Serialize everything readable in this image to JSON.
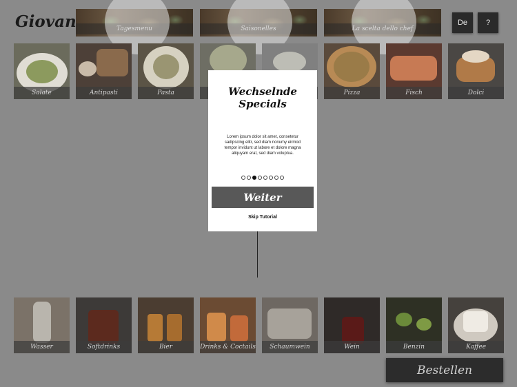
{
  "app": {
    "logo": "Giovanni"
  },
  "banners": [
    {
      "label": "Tagesmenu"
    },
    {
      "label": "Saisonelles"
    },
    {
      "label": "La scelta dello chef"
    }
  ],
  "top_buttons": {
    "language": "De",
    "help": "?"
  },
  "food_categories": [
    "Salate",
    "Antipasti",
    "Pasta",
    "",
    "",
    "Pizza",
    "Fisch",
    "Dolci"
  ],
  "drink_categories": [
    "Wasser",
    "Softdrinks",
    "Bier",
    "Drinks & Coctails",
    "Schaumwein",
    "Wein",
    "Benzin",
    "Kaffee"
  ],
  "tutorial": {
    "title": "Wechselnde Specials",
    "body": "Lorem ipsum dolor sit amet, consetetur sadipscing elitr, sed diam nonumy eirmod tempor invidunt ut labore et dolore magna aliquyam erat, sed diam voluptua.",
    "step_count": 8,
    "active_step": 3,
    "next_label": "Weiter",
    "skip_label": "Skip Tutorial"
  },
  "order_button": {
    "label": "Bestellen"
  },
  "colors": {
    "overlay": "#8a8a8a",
    "caption_bg": "#3c3c3c",
    "dialog_bg": "#ffffff",
    "next_button": "#585858"
  }
}
